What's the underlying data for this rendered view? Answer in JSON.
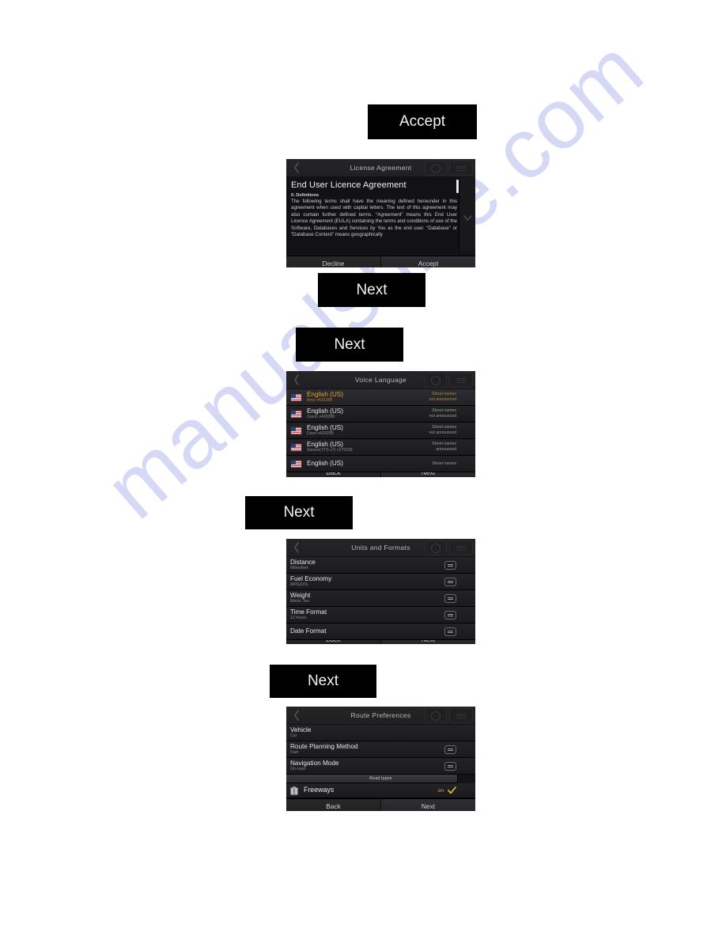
{
  "page": {
    "background": "#ffffff",
    "watermark": {
      "text": "manualshive.com",
      "color": "#c9cdf2"
    }
  },
  "callouts": [
    {
      "id": "accept-1",
      "label": "Accept"
    },
    {
      "id": "next-1",
      "label": "Next"
    },
    {
      "id": "next-2",
      "label": "Next"
    },
    {
      "id": "next-3",
      "label": "Next"
    },
    {
      "id": "next-4",
      "label": "Next"
    }
  ],
  "devices": {
    "eula": {
      "title": "License Agreement",
      "heading": "End User Licence Agreement",
      "section_label": "0. Definitions",
      "body": "The following terms shall have the meaning defined hereunder in this agreement when used with capital letters. The text of this agreement may also contain further defined terms. “Agreement” means this End User Licence Agreement (EULA) containing the terms and conditions of use of the Software, Databases and Services by You as the end user. “Database” or “Database Content” means geographically",
      "actions": {
        "left": "Decline",
        "right": "Accept"
      }
    },
    "voice": {
      "title": "Voice Language",
      "rows": [
        {
          "title": "English (US)",
          "sub": "Amy v429288",
          "right_line1": "Street names",
          "right_line2": "not announced",
          "selected": true
        },
        {
          "title": "English (US)",
          "sub": "Jason v429288",
          "right_line1": "Street names",
          "right_line2": "not announced",
          "selected": false
        },
        {
          "title": "English (US)",
          "sub": "Dave v429288",
          "right_line1": "Street names",
          "right_line2": "not announced",
          "selected": false
        },
        {
          "title": "English (US)",
          "sub": "Steven(TTS v7) v279155",
          "right_line1": "Street names",
          "right_line2": "announced",
          "selected": false
        },
        {
          "title": "English (US)",
          "sub": "",
          "right_line1": "Street names",
          "right_line2": "",
          "selected": false
        }
      ],
      "actions": {
        "left": "Back",
        "right": "Next"
      }
    },
    "units": {
      "title": "Units and Formats",
      "rows": [
        {
          "title": "Distance",
          "sub": "Miles/feet"
        },
        {
          "title": "Fuel Economy",
          "sub": "MPG(US)"
        },
        {
          "title": "Weight",
          "sub": "Metric Ton"
        },
        {
          "title": "Time Format",
          "sub": "12 hours"
        },
        {
          "title": "Date Format",
          "sub": ""
        }
      ],
      "actions": {
        "left": "Back",
        "right": "Next"
      }
    },
    "route": {
      "title": "Route Preferences",
      "rows": [
        {
          "title": "Vehicle",
          "sub": "Car",
          "has_selector": false
        },
        {
          "title": "Route Planning Method",
          "sub": "Fast",
          "has_selector": true
        },
        {
          "title": "Navigation Mode",
          "sub": "On-road",
          "has_selector": true
        }
      ],
      "section_label": "Road types",
      "toggle_row": {
        "title": "Freeways",
        "state": "on"
      },
      "actions": {
        "left": "Back",
        "right": "Next"
      }
    }
  },
  "icons": {
    "back": "chevron-left-icon",
    "search": "magnifier-icon",
    "menu": "menu-icon",
    "scroll_down": "chevron-down-icon",
    "flag": "us-flag-icon",
    "selector": "dropdown-selector-icon",
    "road": "road-icon",
    "check": "check-icon"
  }
}
